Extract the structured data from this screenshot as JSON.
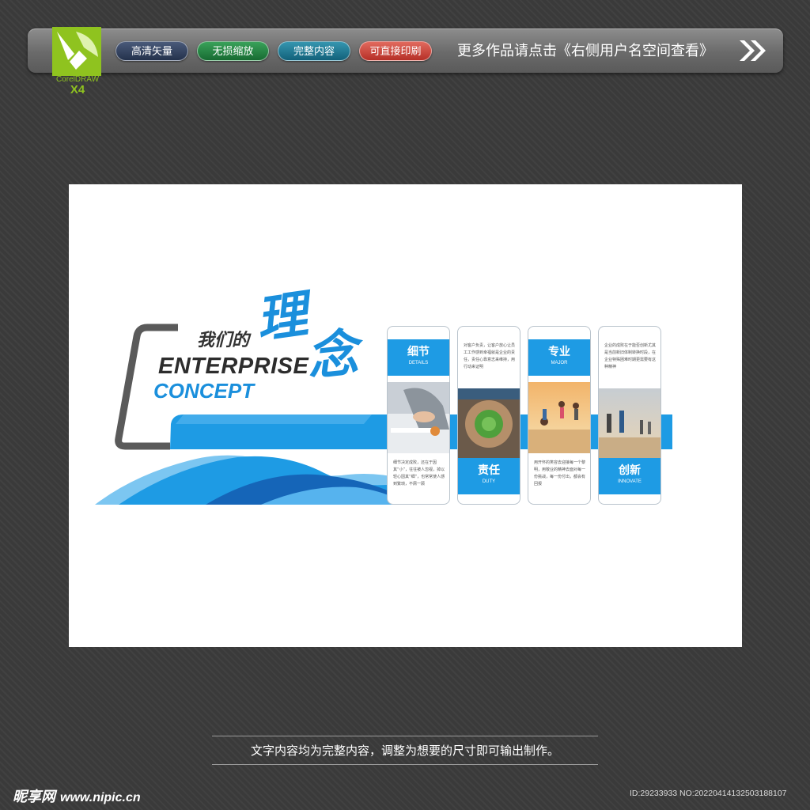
{
  "toolbar": {
    "logo": {
      "brand": "CorelDRAW",
      "version": "X4"
    },
    "pills": [
      "高清矢量",
      "无损缩放",
      "完整内容",
      "可直接印刷"
    ],
    "more_link": "更多作品请点击《右侧用户名空间查看》",
    "arrow_icon": "double-chevron-right-icon"
  },
  "design": {
    "title_small": "我们的",
    "title_big_1": "理",
    "title_big_2": "念",
    "title_en_1": "ENTERPRISE",
    "title_en_2": "CONCEPT",
    "cards": [
      {
        "cn": "细节",
        "en": "DETAILS",
        "text": "细节决定成败，还在于因其“小”，往往被人忽视，掉以轻心因其“细”，也常常使人感到繁琐，不屑一顾"
      },
      {
        "cn": "责任",
        "en": "DUTY",
        "text": "对客户负责，让客户放心让员工工作感到幸福就是企业的责任，责任心靠意志来维持，用行动来证明"
      },
      {
        "cn": "专业",
        "en": "MAJOR",
        "text": "用开怀的笑容去迎接每一个黎明，用敬业的精神去面对每一份挑战，每一份付出，都会有回报"
      },
      {
        "cn": "创新",
        "en": "INNOVATE",
        "text": "企业的成败在于能否创新尤其是当前新旧体制转换时段，在企业特殊困难时期更需要有这种精神"
      }
    ],
    "colors": {
      "accent": "#1e9be4",
      "dark": "#2d2d2d"
    }
  },
  "footer": {
    "caption": "文字内容均为完整内容，调整为想要的尺寸即可输出制作。",
    "site_logo": "昵享网",
    "site_url": "www.nipic.cn",
    "id_text": "ID:29233933 NO:20220414132503188107"
  }
}
